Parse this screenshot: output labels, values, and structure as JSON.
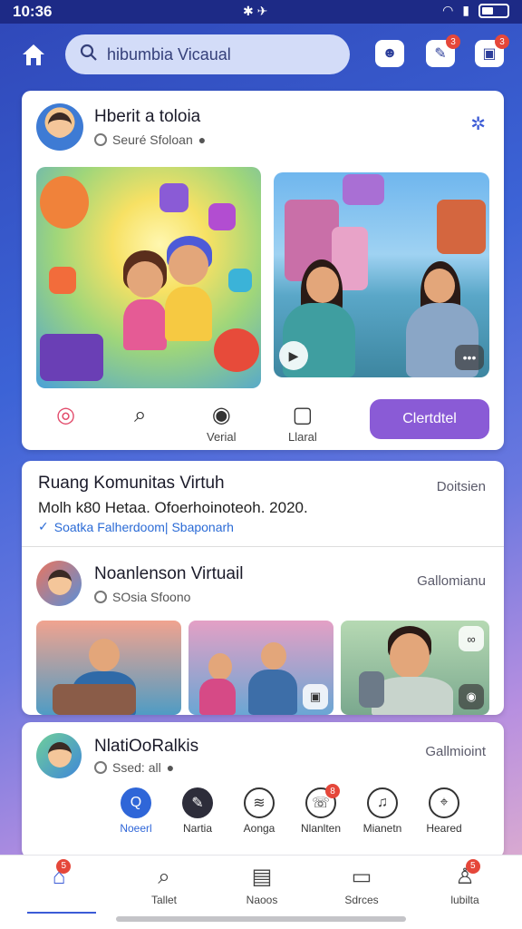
{
  "status": {
    "time": "10:36"
  },
  "topbar": {
    "search_placeholder": "hibumbia Vicaual",
    "badges": [
      "3",
      "3"
    ]
  },
  "post1": {
    "name": "Hberit a toloia",
    "sub": "Seuré Sfoloan",
    "actions": [
      {
        "label": ""
      },
      {
        "label": ""
      },
      {
        "label": "Verial"
      },
      {
        "label": "Llaral"
      }
    ],
    "primary_button": "Clertdtel"
  },
  "post2": {
    "title": "Ruang Komunitas Virtuh",
    "right_label": "Doitsien",
    "line": "Molh k80 Hetaa. Ofoerhoinoteoh. 2020.",
    "link": "Soatka Falherdoom| Sbaponarh"
  },
  "post3": {
    "name": "Noanlenson Virtuail",
    "sub": "SOsia Sfoono",
    "right_label": "Gallomianu"
  },
  "post4": {
    "name": "NlatiOoRalkis",
    "sub": "Ssed: all",
    "right_label": "Gallmioint",
    "categories": [
      {
        "label": "Noeerl",
        "badge": ""
      },
      {
        "label": "Nartia",
        "badge": ""
      },
      {
        "label": "Aonga",
        "badge": ""
      },
      {
        "label": "Nlanlten",
        "badge": "8"
      },
      {
        "label": "Mianetn",
        "badge": ""
      },
      {
        "label": "Heared",
        "badge": ""
      }
    ]
  },
  "bottom_nav": [
    {
      "label": "",
      "badge": "5"
    },
    {
      "label": "Tallet",
      "badge": ""
    },
    {
      "label": "Naoos",
      "badge": ""
    },
    {
      "label": "Sdrces",
      "badge": ""
    },
    {
      "label": "lubilta",
      "badge": "5"
    }
  ]
}
